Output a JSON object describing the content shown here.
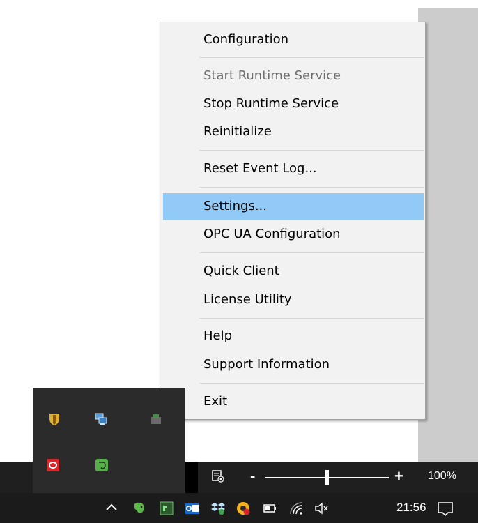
{
  "context_menu": {
    "items": [
      {
        "label": "Configuration"
      },
      {
        "label": "Start Runtime Service",
        "disabled": true
      },
      {
        "label": "Stop Runtime Service"
      },
      {
        "label": "Reinitialize"
      },
      {
        "label": "Reset Event Log..."
      },
      {
        "label": "Settings...",
        "highlighted": true
      },
      {
        "label": "OPC UA Configuration"
      },
      {
        "label": "Quick Client"
      },
      {
        "label": "License Utility"
      },
      {
        "label": "Help"
      },
      {
        "label": "Support Information"
      },
      {
        "label": "Exit"
      }
    ],
    "highlight_color": "#91c9f7"
  },
  "tray_flyout": {
    "icons": [
      "shield-icon",
      "network-monitor-icon",
      "tray-app-icon",
      "opera-icon",
      "evernote-icon"
    ]
  },
  "status_bar": {
    "zoom_minus": "-",
    "zoom_plus": "+",
    "zoom_percent": "100%",
    "zoom_level": 1.0
  },
  "taskbar": {
    "icons": [
      "chevron-up-icon",
      "evernote-icon",
      "app-icon",
      "outlook-icon",
      "dropbox-icon",
      "notification-app-icon",
      "battery-icon",
      "wifi-icon",
      "volume-muted-icon",
      "action-center-icon"
    ],
    "time": "21:56"
  }
}
